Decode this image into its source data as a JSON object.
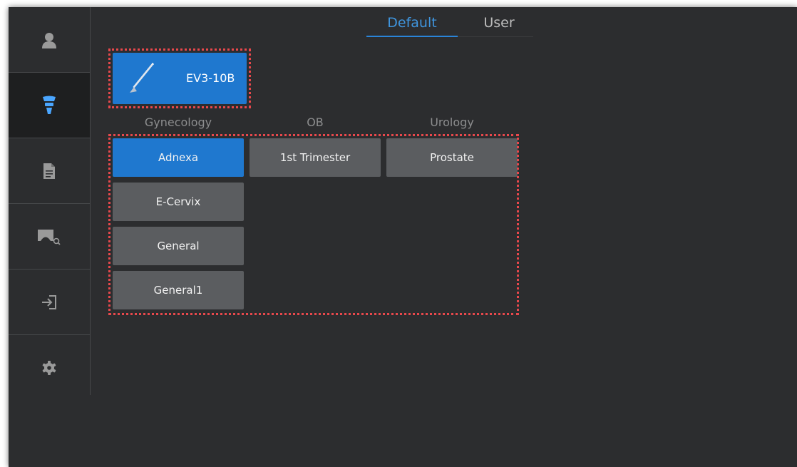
{
  "tabs": {
    "default": "Default",
    "user": "User"
  },
  "probe": {
    "name": "EV3-10B"
  },
  "categories": [
    "Gynecology",
    "OB",
    "Urology"
  ],
  "presets": {
    "adnexa": "Adnexa",
    "first_trimester": "1st Trimester",
    "prostate": "Prostate",
    "e_cervix": "E-Cervix",
    "general": "General",
    "general1": "General1"
  },
  "sidebar": {
    "items": [
      {
        "icon": "user-icon"
      },
      {
        "icon": "probe-icon",
        "active": true
      },
      {
        "icon": "document-icon"
      },
      {
        "icon": "image-review-icon"
      },
      {
        "icon": "exit-icon"
      },
      {
        "icon": "gear-icon"
      }
    ]
  },
  "colors": {
    "accent": "#1f78cf",
    "tab_active": "#3f95de",
    "highlight_outline": "#e8484c"
  }
}
